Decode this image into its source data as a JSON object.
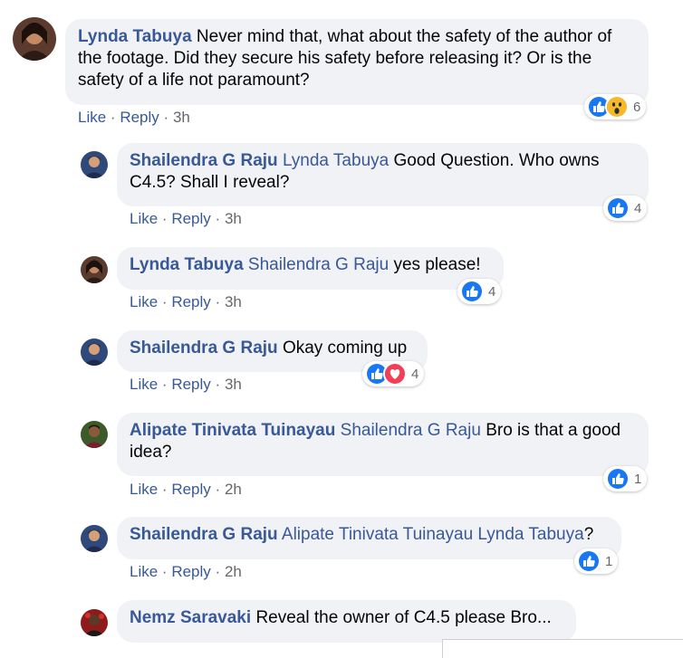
{
  "comments": [
    {
      "author": "Lynda Tabuya",
      "mention": "",
      "text": "Never mind that, what about the safety of the author of the footage. Did they secure his safety before releasing it? Or is the safety of a life not paramount?",
      "like": "Like",
      "reply": "Reply",
      "time": "3h",
      "reaction_count": "6",
      "reactions": [
        "like-icon",
        "wow-icon"
      ]
    },
    {
      "author": "Shailendra G Raju",
      "mention": "Lynda Tabuya",
      "text": "Good Question. Who owns C4.5? Shall I reveal?",
      "like": "Like",
      "reply": "Reply",
      "time": "3h",
      "reaction_count": "4",
      "reactions": [
        "like-icon"
      ]
    },
    {
      "author": "Lynda Tabuya",
      "mention": "Shailendra G Raju",
      "text": "yes please!",
      "like": "Like",
      "reply": "Reply",
      "time": "3h",
      "reaction_count": "4",
      "reactions": [
        "like-icon"
      ]
    },
    {
      "author": "Shailendra G Raju",
      "mention": "",
      "text": "Okay coming up",
      "like": "Like",
      "reply": "Reply",
      "time": "3h",
      "reaction_count": "4",
      "reactions": [
        "like-icon",
        "love-icon"
      ]
    },
    {
      "author": "Alipate Tinivata Tuinayau",
      "mention": "Shailendra G Raju",
      "text": "Bro is that a good idea?",
      "like": "Like",
      "reply": "Reply",
      "time": "2h",
      "reaction_count": "1",
      "reactions": [
        "like-icon"
      ]
    },
    {
      "author": "Shailendra G Raju",
      "mention": "Alipate Tinivata Tuinayau Lynda Tabuya",
      "text": "?",
      "like": "Like",
      "reply": "Reply",
      "time": "2h",
      "reaction_count": "1",
      "reactions": [
        "like-icon"
      ]
    },
    {
      "author": "Nemz Saravaki",
      "mention": "",
      "text": "Reveal the owner of C4.5 please Bro...",
      "like": "",
      "reply": "",
      "time": "",
      "reaction_count": "",
      "reactions": []
    }
  ],
  "separator": "·",
  "colors": {
    "author": "#385898",
    "bubble": "#f0f2f5",
    "like_blue": "#1877f2",
    "love_red": "#f33e58",
    "wow_yellow": "#f7b928",
    "meta_gray": "#65676b"
  }
}
